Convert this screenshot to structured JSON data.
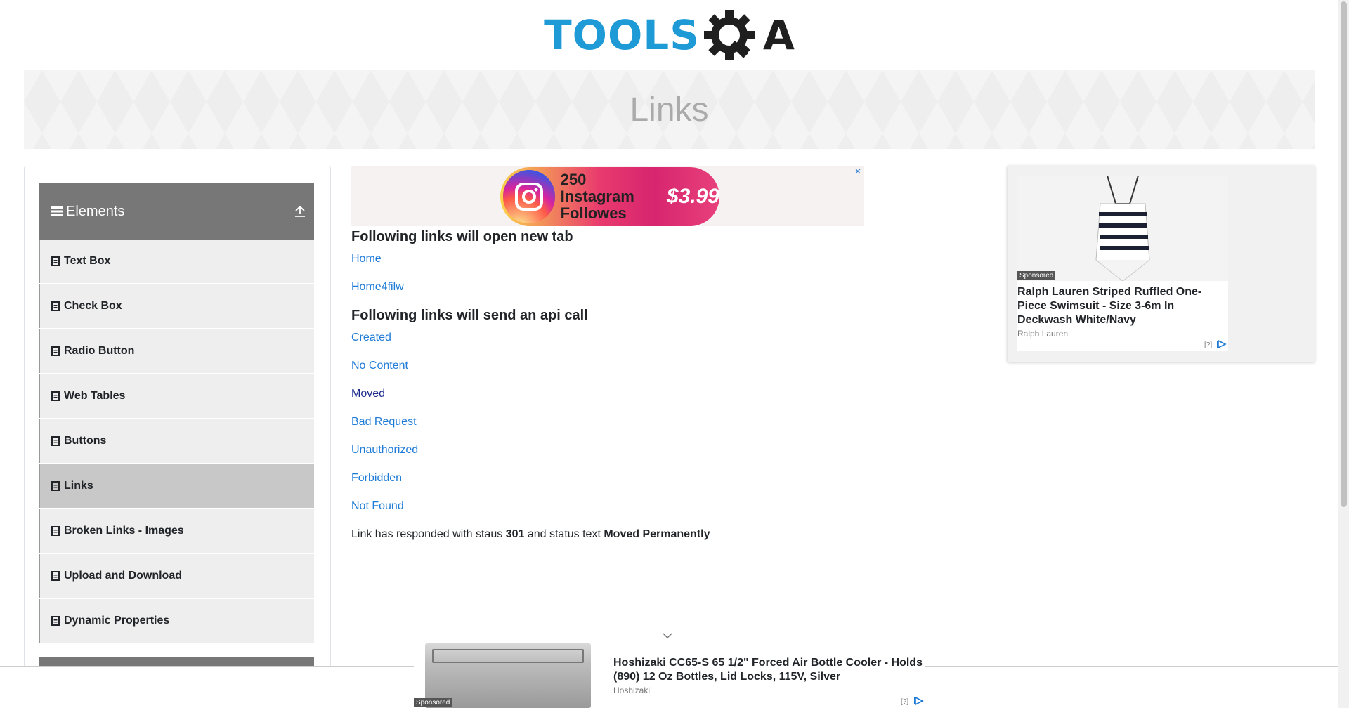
{
  "logo": {
    "text": "TOOLS",
    "accent": "A"
  },
  "banner": {
    "title": "Links"
  },
  "sidebar": {
    "group": {
      "title": "Elements"
    },
    "items": [
      {
        "label": "Text Box"
      },
      {
        "label": "Check Box"
      },
      {
        "label": "Radio Button"
      },
      {
        "label": "Web Tables"
      },
      {
        "label": "Buttons"
      },
      {
        "label": "Links"
      },
      {
        "label": "Broken Links - Images"
      },
      {
        "label": "Upload and Download"
      },
      {
        "label": "Dynamic Properties"
      }
    ]
  },
  "top_ad": {
    "text_line1": "250 Instagram",
    "text_line2": "Followes",
    "price": "$3.99",
    "close": "×"
  },
  "main": {
    "heading_new_tab": "Following links will open new tab",
    "new_tab_links": [
      "Home",
      "Home4filw"
    ],
    "heading_api": "Following links will send an api call",
    "api_links": [
      "Created",
      "No Content",
      "Moved",
      "Bad Request",
      "Unauthorized",
      "Forbidden",
      "Not Found"
    ],
    "response": {
      "prefix": "Link has responded with staus ",
      "status": "301",
      "middle": " and status text ",
      "status_text": "Moved Permanently"
    }
  },
  "right_ad": {
    "sponsored": "Sponsored",
    "title": "Ralph Lauren Striped Ruffled One-Piece Swimsuit - Size 3-6m In Deckwash White/Navy",
    "brand": "Ralph Lauren",
    "help": "[?]"
  },
  "bottom_ad": {
    "sponsored": "Sponsored",
    "title": "Hoshizaki CC65-S 65 1/2\" Forced Air Bottle Cooler - Holds (890) 12 Oz Bottles, Lid Locks, 115V, Silver",
    "brand": "Hoshizaki",
    "help": "[?]"
  },
  "colors": {
    "brand_blue": "#1e9bd7",
    "link_blue": "#1e7bd7",
    "header_gray": "#777777",
    "active_item": "#c8c8c8"
  }
}
